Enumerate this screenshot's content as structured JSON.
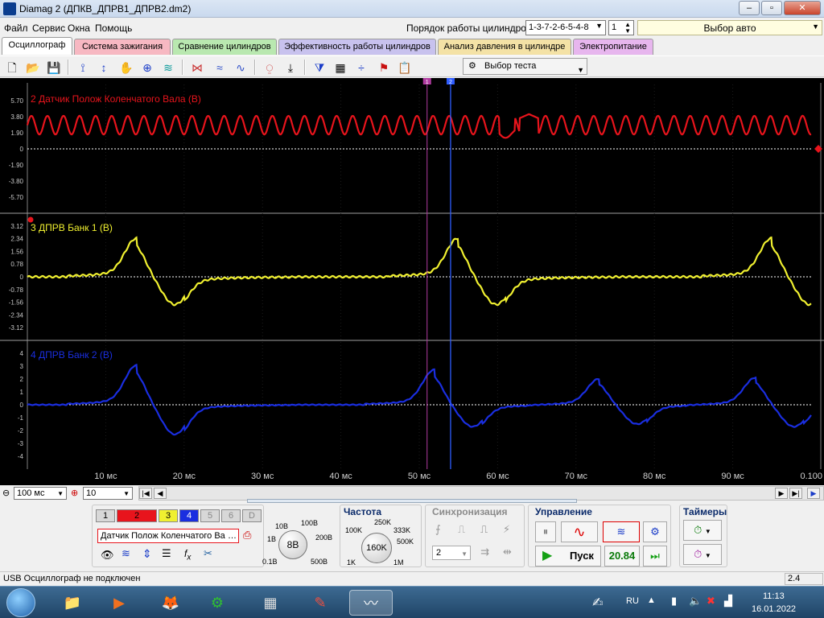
{
  "window": {
    "title": "Diamag 2 (ДПКВ_ДПРВ1_ДПРВ2.dm2)",
    "buttons": {
      "minimize": "–",
      "maximize": "▫",
      "close": "✕"
    }
  },
  "menu": {
    "items": [
      "Файл",
      "Сервис",
      "Окна",
      "Помощь"
    ],
    "cylinder_order_label": "Порядок работы цилиндров",
    "cylinder_order_value": "1-3-7-2-6-5-4-8",
    "cylinder_number": "1",
    "car_select": "Выбор авто"
  },
  "tabs": [
    {
      "label": "Осциллограф",
      "color": "#ffffff"
    },
    {
      "label": "Система зажигания",
      "color": "#f7b8c2"
    },
    {
      "label": "Сравнение цилиндров",
      "color": "#b9e8b0"
    },
    {
      "label": "Эффективность работы цилиндров",
      "color": "#c8c2ee"
    },
    {
      "label": "Анализ давления в цилиндре",
      "color": "#f4e2a6"
    },
    {
      "label": "Электропитание",
      "color": "#e7b6ee"
    }
  ],
  "toolbar": {
    "test_select": "Выбор теста"
  },
  "cursors": [
    "1",
    "2"
  ],
  "chart_data": [
    {
      "type": "line",
      "title": "2 Датчик Полож Коленчатого Вала (В)",
      "color": "#e8141c",
      "yticks": [
        "5.70",
        "3.80",
        "1.90",
        "0",
        "-1.90",
        "-3.80",
        "-5.70"
      ],
      "ylim": [
        -7.6,
        7.6
      ],
      "series": [
        {
          "shape": "sine",
          "period_ms": 2.05,
          "center": 2.8,
          "amplitude": 1.1,
          "gap_ms": 61,
          "bump_ms": 64
        }
      ]
    },
    {
      "type": "line",
      "title": "3 ДПРВ Банк 1 (В)",
      "color": "#f0f030",
      "yticks": [
        "3.12",
        "2.34",
        "1.56",
        "0.78",
        "0",
        "-0.78",
        "-1.56",
        "-2.34",
        "-3.12"
      ],
      "ylim": [
        -3.9,
        3.9
      ],
      "series": [
        {
          "pulse_centers_ms": [
            14,
            55,
            95
          ],
          "peak": 2.0,
          "trough": -1.7
        }
      ]
    },
    {
      "type": "line",
      "title": "4 ДПРВ Банк 2 (В)",
      "color": "#1a2ee0",
      "yticks": [
        "4",
        "3",
        "2",
        "1",
        "0",
        "-1",
        "-2",
        "-3",
        "-4"
      ],
      "ylim": [
        -5,
        5
      ],
      "series": [
        {
          "pulse_centers_ms": [
            14,
            52,
            73,
            93
          ],
          "peaks": [
            2.6,
            2.3,
            1.7,
            1.8
          ],
          "troughs": [
            -2.3,
            -1.7,
            -1.5,
            -1.7
          ]
        }
      ]
    }
  ],
  "time_axis": {
    "labels": [
      "10 мс",
      "20 мс",
      "30 мс",
      "40 мс",
      "50 мс",
      "60 мс",
      "70 мс",
      "80 мс",
      "90 мс",
      "0.100"
    ],
    "range_ms": [
      0,
      100
    ],
    "cursor1_ms": 51,
    "cursor2_ms": 54
  },
  "controls": {
    "timebase": "100 мс",
    "count": "10",
    "channels": [
      "1",
      "2",
      "3",
      "4",
      "5",
      "6",
      "D"
    ],
    "channel_colors": [
      "#d8d8d8",
      "#e8141c",
      "#f0f030",
      "#1a2ee0",
      "#d8d8d8",
      "#d8d8d8",
      "#d8d8d8"
    ],
    "sensor_name": "Датчик Полож Коленчатого Ва",
    "voltage_knob": "8В",
    "voltage_marks": [
      "10В",
      "100В",
      "1В",
      "200В",
      "0.1В",
      "500В"
    ],
    "frequency_title": "Частота",
    "frequency_knob": "160K",
    "frequency_marks": [
      "250K",
      "100K",
      "333K",
      "500K",
      "1K",
      "1M"
    ],
    "sync_title": "Синхронизация",
    "sync_value": "2",
    "control_title": "Управление",
    "start_label": "Пуск",
    "value_display": "20.84",
    "timers_title": "Таймеры"
  },
  "status": {
    "text": "USB Осциллограф не подключен",
    "right": "2.4"
  },
  "taskbar": {
    "language": "RU",
    "time": "11:13",
    "date": "16.01.2022"
  }
}
